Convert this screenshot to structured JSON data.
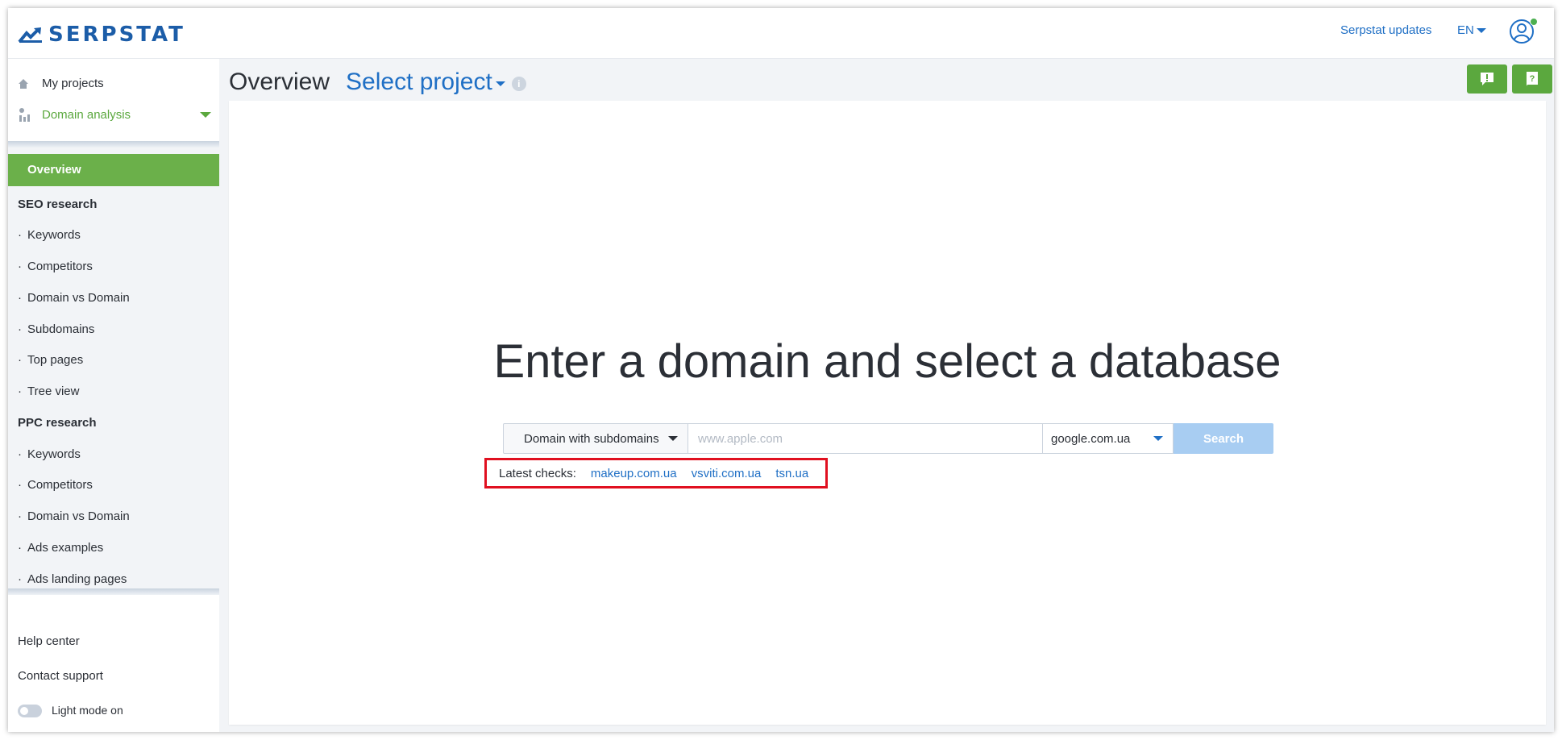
{
  "brand": {
    "name": "SERPSTAT",
    "logo_icon": "serpstat-chart-arrow-icon"
  },
  "topbar": {
    "updates_label": "Serpstat updates",
    "language": "EN",
    "avatar_icon": "user-avatar-icon"
  },
  "sidebar": {
    "my_projects": "My projects",
    "domain_analysis": "Domain analysis",
    "active_item": "Overview",
    "seo_section": "SEO research",
    "seo_items": [
      "Keywords",
      "Competitors",
      "Domain vs Domain",
      "Subdomains",
      "Top pages",
      "Tree view"
    ],
    "ppc_section": "PPC research",
    "ppc_items": [
      "Keywords",
      "Competitors",
      "Domain vs Domain",
      "Ads examples",
      "Ads landing pages"
    ],
    "help_center": "Help center",
    "contact_support": "Contact support",
    "light_mode": "Light mode on"
  },
  "main": {
    "page_title": "Overview",
    "project_select": "Select project",
    "headline": "Enter a domain and select a database",
    "search": {
      "scope": "Domain with subdomains",
      "placeholder": "www.apple.com",
      "database": "google.com.ua",
      "button": "Search"
    },
    "latest": {
      "label": "Latest checks:",
      "links": [
        "makeup.com.ua",
        "vsviti.com.ua",
        "tsn.ua"
      ]
    }
  },
  "colors": {
    "accent_green": "#5ba83e",
    "link_blue": "#1f6fc5",
    "highlight_red": "#e01020",
    "search_button": "#a8cdf2"
  }
}
